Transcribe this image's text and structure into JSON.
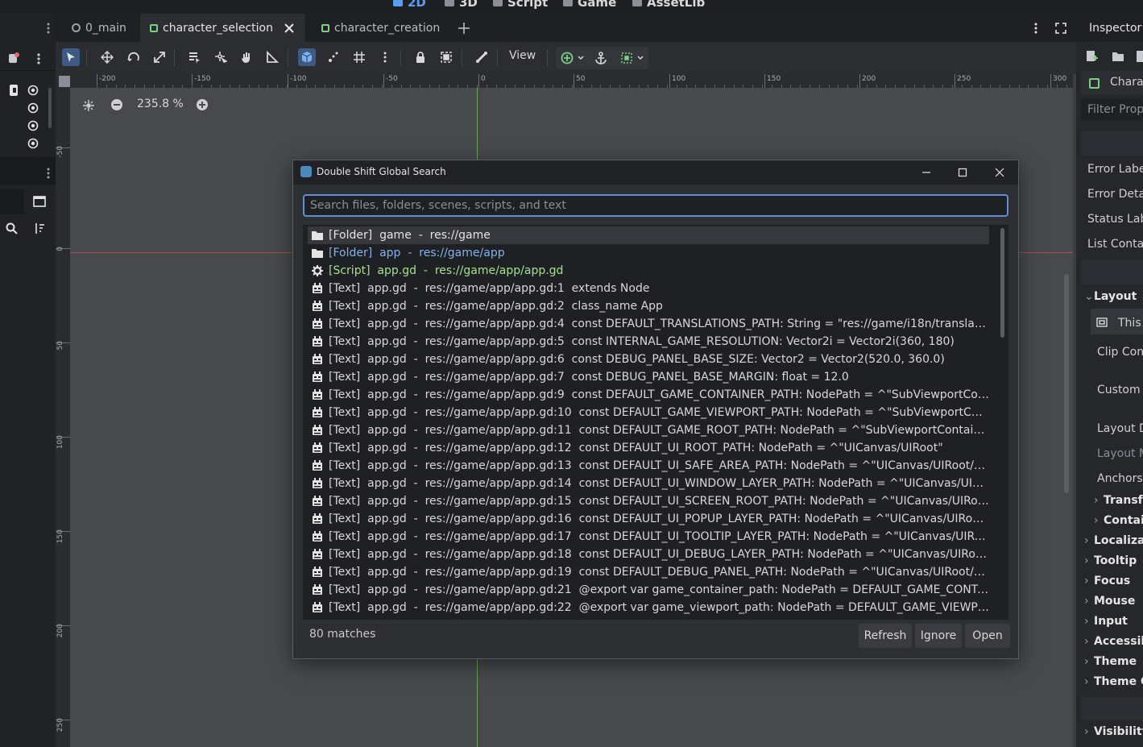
{
  "top_modes": [
    {
      "label": "2D",
      "icon": "2d-mode-icon"
    },
    {
      "label": "3D",
      "icon": "3d-mode-icon"
    },
    {
      "label": "Script",
      "icon": "script-mode-icon"
    },
    {
      "label": "Game",
      "icon": "game-mode-icon"
    },
    {
      "label": "AssetLib",
      "icon": "assetlib-mode-icon"
    }
  ],
  "tabs": [
    {
      "label": "0_main",
      "icon": "scene-circle-icon"
    },
    {
      "label": "character_selection",
      "icon": "control-node-icon",
      "active": true
    },
    {
      "label": "character_creation",
      "icon": "control-node-icon"
    }
  ],
  "toolbar": {
    "view_label": "View"
  },
  "ruler": {
    "h_ticks": [
      "-200",
      "-150",
      "-100",
      "-50",
      "0",
      "50",
      "100",
      "150",
      "200",
      "250",
      "300"
    ],
    "v_ticks": [
      "-50",
      "0",
      "50",
      "100",
      "150",
      "200",
      "250"
    ]
  },
  "viewport": {
    "zoom_label": "235.8 %"
  },
  "inspector": {
    "tab_label": "Inspector",
    "node_label": "Chara",
    "filter_placeholder": "Filter Prop",
    "items": [
      "Error Labe",
      "Error Detai",
      "Status Lab",
      "List Contai"
    ],
    "layout_section": "Layout",
    "layout_this": "This",
    "layout_items": [
      "Clip Con",
      "Custom",
      "Layout D",
      "Layout M",
      "Anchors"
    ],
    "sub_sections": [
      "Transfo",
      "Contai"
    ],
    "sections": [
      "Localiza",
      "Tooltip",
      "Focus",
      "Mouse",
      "Input",
      "Accessib",
      "Theme",
      "Theme C"
    ],
    "visibility": "Visibility"
  },
  "dialog": {
    "title": "Double Shift Global Search",
    "search_placeholder": "Search files, folders, scenes, scripts, and text",
    "search_value": "",
    "results": [
      {
        "type": "folder",
        "text": "[Folder]  game  -  res://game"
      },
      {
        "type": "folder",
        "text": "[Folder]  app  -  res://game/app"
      },
      {
        "type": "script",
        "text": "[Script]  app.gd  -  res://game/app/app.gd"
      },
      {
        "type": "text",
        "text": "[Text]  app.gd  -  res://game/app/app.gd:1  extends Node"
      },
      {
        "type": "text",
        "text": "[Text]  app.gd  -  res://game/app/app.gd:2  class_name App"
      },
      {
        "type": "text",
        "text": "[Text]  app.gd  -  res://game/app/app.gd:4  const DEFAULT_TRANSLATIONS_PATH: String = \"res://game/i18n/translations..."
      },
      {
        "type": "text",
        "text": "[Text]  app.gd  -  res://game/app/app.gd:5  const INTERNAL_GAME_RESOLUTION: Vector2i = Vector2i(360, 180)"
      },
      {
        "type": "text",
        "text": "[Text]  app.gd  -  res://game/app/app.gd:6  const DEBUG_PANEL_BASE_SIZE: Vector2 = Vector2(520.0, 360.0)"
      },
      {
        "type": "text",
        "text": "[Text]  app.gd  -  res://game/app/app.gd:7  const DEBUG_PANEL_BASE_MARGIN: float = 12.0"
      },
      {
        "type": "text",
        "text": "[Text]  app.gd  -  res://game/app/app.gd:9  const DEFAULT_GAME_CONTAINER_PATH: NodePath = ^\"SubViewportContain..."
      },
      {
        "type": "text",
        "text": "[Text]  app.gd  -  res://game/app/app.gd:10  const DEFAULT_GAME_VIEWPORT_PATH: NodePath = ^\"SubViewportContain..."
      },
      {
        "type": "text",
        "text": "[Text]  app.gd  -  res://game/app/app.gd:11  const DEFAULT_GAME_ROOT_PATH: NodePath = ^\"SubViewportContainer/Su..."
      },
      {
        "type": "text",
        "text": "[Text]  app.gd  -  res://game/app/app.gd:12  const DEFAULT_UI_ROOT_PATH: NodePath = ^\"UICanvas/UIRoot\""
      },
      {
        "type": "text",
        "text": "[Text]  app.gd  -  res://game/app/app.gd:13  const DEFAULT_UI_SAFE_AREA_PATH: NodePath = ^\"UICanvas/UIRoot/Safe..."
      },
      {
        "type": "text",
        "text": "[Text]  app.gd  -  res://game/app/app.gd:14  const DEFAULT_UI_WINDOW_LAYER_PATH: NodePath = ^\"UICanvas/UIRoot..."
      },
      {
        "type": "text",
        "text": "[Text]  app.gd  -  res://game/app/app.gd:15  const DEFAULT_UI_SCREEN_ROOT_PATH: NodePath = ^\"UICanvas/UIRoot/..."
      },
      {
        "type": "text",
        "text": "[Text]  app.gd  -  res://game/app/app.gd:16  const DEFAULT_UI_POPUP_LAYER_PATH: NodePath = ^\"UICanvas/UIRoot/P..."
      },
      {
        "type": "text",
        "text": "[Text]  app.gd  -  res://game/app/app.gd:17  const DEFAULT_UI_TOOLTIP_LAYER_PATH: NodePath = ^\"UICanvas/UIRoot/..."
      },
      {
        "type": "text",
        "text": "[Text]  app.gd  -  res://game/app/app.gd:18  const DEFAULT_UI_DEBUG_LAYER_PATH: NodePath = ^\"UICanvas/UIRoot/D..."
      },
      {
        "type": "text",
        "text": "[Text]  app.gd  -  res://game/app/app.gd:19  const DEFAULT_DEBUG_PANEL_PATH: NodePath = ^\"UICanvas/UIRoot/Debu..."
      },
      {
        "type": "text",
        "text": "[Text]  app.gd  -  res://game/app/app.gd:21  @export var game_container_path: NodePath = DEFAULT_GAME_CONTAINE..."
      },
      {
        "type": "text",
        "text": "[Text]  app.gd  -  res://game/app/app.gd:22  @export var game_viewport_path: NodePath = DEFAULT_GAME_VIEWPORT_..."
      }
    ],
    "match_count": "80 matches",
    "buttons": {
      "refresh": "Refresh",
      "ignore": "Ignore",
      "open": "Open"
    }
  },
  "colors": {
    "accent": "#5c8fd6",
    "folder_highlight": "#7fb2ef",
    "script_green": "#a3e08f",
    "node_green": "#7ad27a"
  }
}
